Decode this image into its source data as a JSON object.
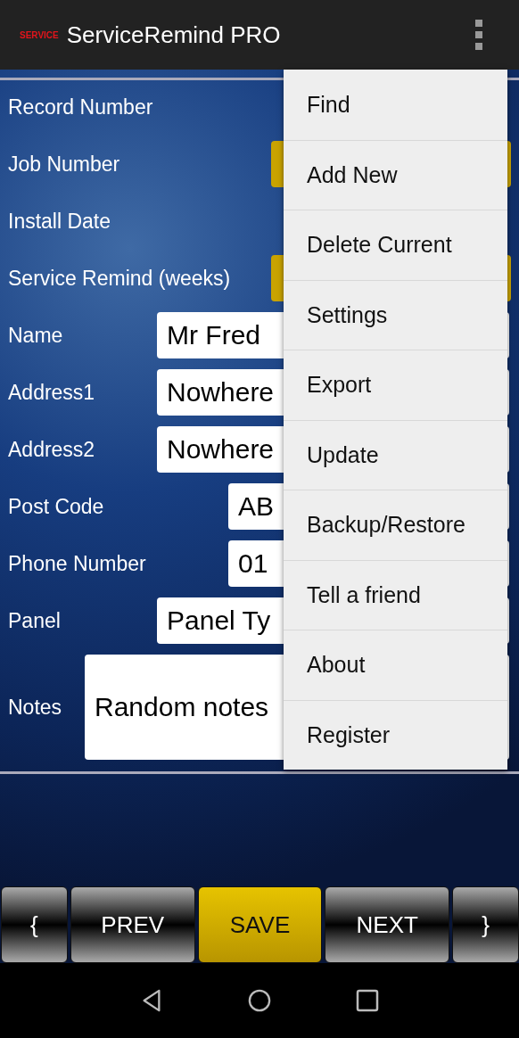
{
  "app_bar": {
    "logo": "SERVICE",
    "title": "ServiceRemind PRO"
  },
  "form": [
    {
      "label": "Record Number",
      "kind": "none"
    },
    {
      "label": "Job Number",
      "kind": "locked"
    },
    {
      "label": "Install Date",
      "kind": "none"
    },
    {
      "label": "Service Remind (weeks)",
      "kind": "locked"
    },
    {
      "label": "Name",
      "kind": "wide",
      "value": "Mr Fred"
    },
    {
      "label": "Address1",
      "kind": "wide",
      "value": "Nowhere"
    },
    {
      "label": "Address2",
      "kind": "wide",
      "value": "Nowhere"
    },
    {
      "label": "Post Code",
      "kind": "short",
      "value": "AB"
    },
    {
      "label": "Phone Number",
      "kind": "short",
      "value": "01"
    },
    {
      "label": "Panel",
      "kind": "wide",
      "value": "Panel Ty"
    },
    {
      "label": "Notes",
      "kind": "notes",
      "value": "Random notes"
    }
  ],
  "menu": [
    "Find",
    "Add New",
    "Delete Current",
    "Settings",
    "Export",
    "Update",
    "Backup/Restore",
    "Tell a friend",
    "About",
    "Register"
  ],
  "buttons": [
    {
      "label": "{",
      "kind": "small",
      "selected": false
    },
    {
      "label": "PREV",
      "kind": "wide",
      "selected": false
    },
    {
      "label": "SAVE",
      "kind": "wide",
      "selected": true
    },
    {
      "label": "NEXT",
      "kind": "wide",
      "selected": false
    },
    {
      "label": "}",
      "kind": "small",
      "selected": false
    }
  ]
}
